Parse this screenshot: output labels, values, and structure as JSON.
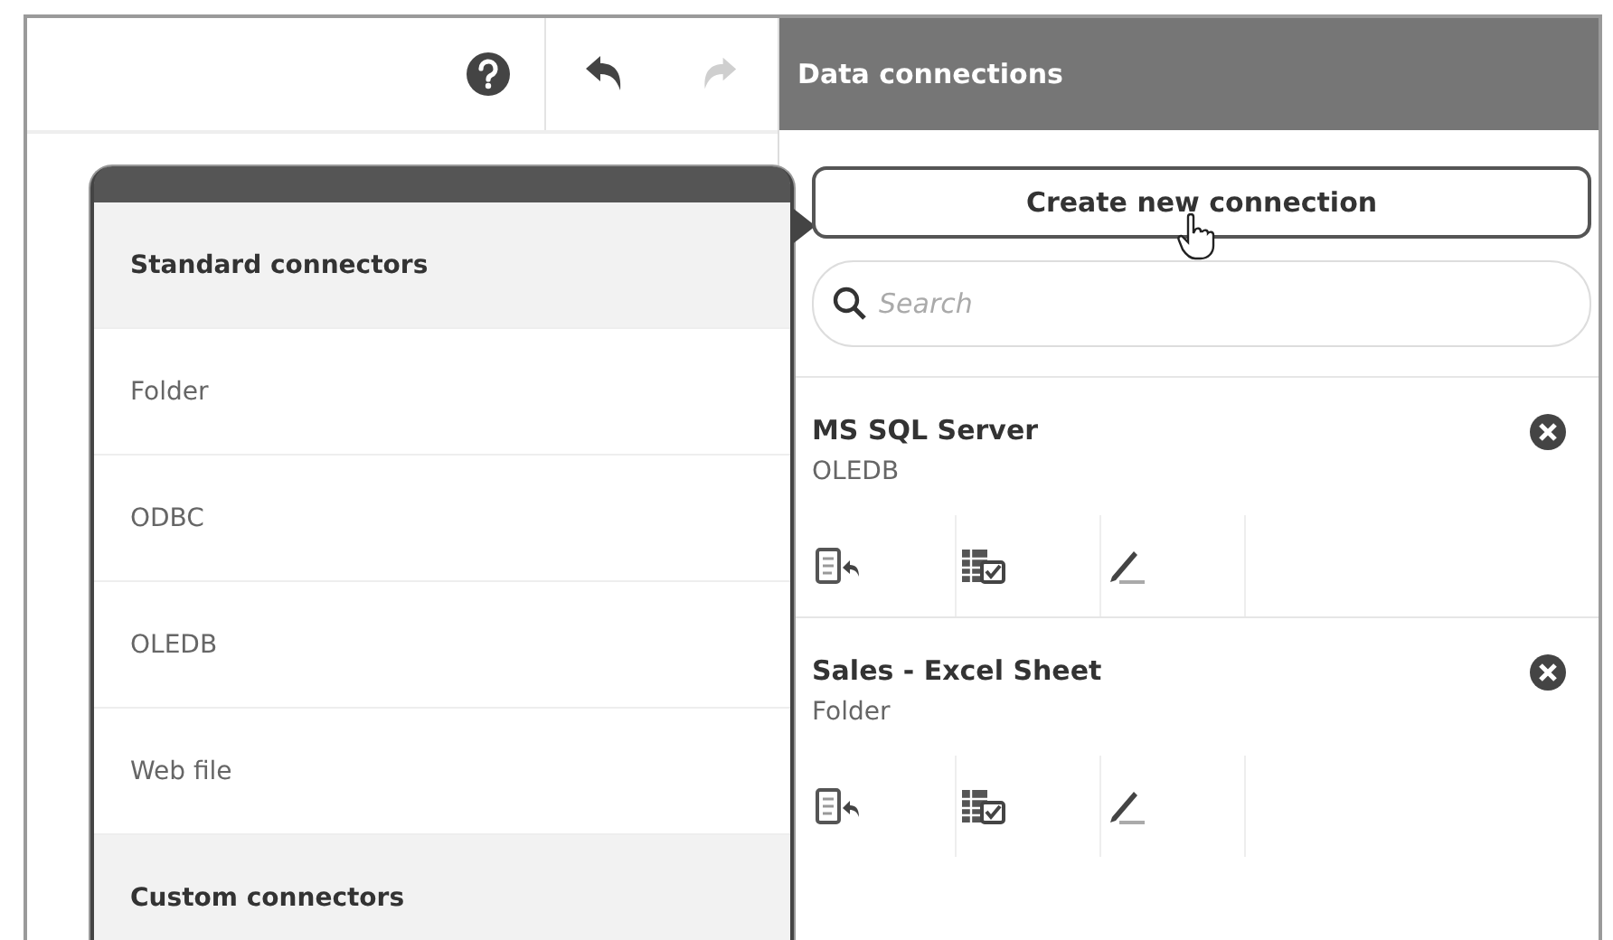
{
  "toolbar": {
    "buttons": [
      {
        "kind": "help",
        "disabled": false
      },
      {
        "kind": "undo",
        "disabled": false
      },
      {
        "kind": "redo",
        "disabled": true
      }
    ]
  },
  "connector_menu": {
    "items": [
      {
        "kind": "header",
        "label": "Standard connectors"
      },
      {
        "kind": "item",
        "label": "Folder"
      },
      {
        "kind": "item",
        "label": "ODBC"
      },
      {
        "kind": "item",
        "label": "OLEDB"
      },
      {
        "kind": "item",
        "label": "Web file"
      },
      {
        "kind": "header",
        "label": "Custom connectors"
      }
    ]
  },
  "data_connections": {
    "title": "Data connections",
    "create_button": "Create new connection",
    "search": {
      "placeholder": "Search"
    },
    "connections": [
      {
        "name": "MS SQL Server",
        "type": "OLEDB"
      },
      {
        "name": "Sales - Excel Sheet",
        "type": "Folder"
      }
    ]
  }
}
